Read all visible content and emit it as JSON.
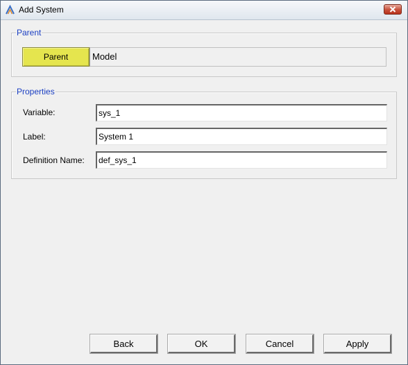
{
  "window": {
    "title": "Add System",
    "app_icon": "app-logo-icon",
    "close_icon": "close-icon"
  },
  "parent_group": {
    "legend": "Parent",
    "button_label": "Parent",
    "value": "Model"
  },
  "properties_group": {
    "legend": "Properties",
    "fields": [
      {
        "label": "Variable:",
        "value": "sys_1"
      },
      {
        "label": "Label:",
        "value": "System 1"
      },
      {
        "label": "Definition Name:",
        "value": "def_sys_1"
      }
    ]
  },
  "footer": {
    "back": "Back",
    "ok": "OK",
    "cancel": "Cancel",
    "apply": "Apply"
  },
  "colors": {
    "legend_text": "#1a3ec2",
    "parent_button": "#e5e54e",
    "close_button": "#c7503a"
  }
}
